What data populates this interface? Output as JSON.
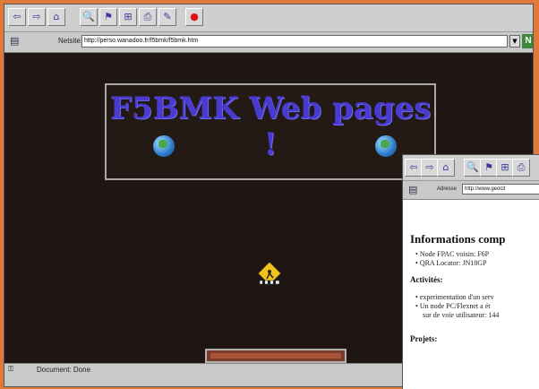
{
  "main_window": {
    "toolbar_icons": [
      "back-icon",
      "forward-icon",
      "home-icon",
      "search-icon",
      "bookmarks-icon",
      "history-icon",
      "print-icon",
      "find-icon",
      "stop-icon"
    ],
    "toolbar_glyphs": [
      "⇦",
      "⇨",
      "⌂",
      "🔍",
      "⚑",
      "⊞",
      "⎙",
      "✎",
      "●"
    ],
    "address_label": "Netsite:",
    "address_value": "http://perso.wanadoo.fr/f5bmk/f5bmk.htm",
    "page_title": "F5BMK Web pages !",
    "status_text": "Document: Done"
  },
  "second_window": {
    "address_label": "Adresse",
    "address_value": "http://www.geocit",
    "heading": "Informations comp",
    "list1": [
      "Node FPAC voisin: F6P",
      "QRA Locator: JN18GP"
    ],
    "section_activites": "Activités:",
    "list2": [
      "experimentation d'un serv",
      "Un node PC/Flexnet a ét",
      "sur de voie utilisateur: 144"
    ],
    "section_projets": "Projets:"
  },
  "colors": {
    "page_bg": "#1f1512",
    "title": "#4a3bd0",
    "frame": "#e07a3a"
  }
}
